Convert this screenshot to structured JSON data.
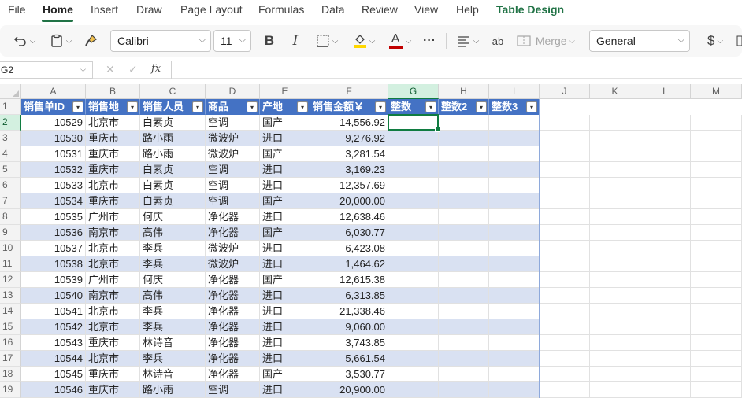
{
  "menu": {
    "items": [
      "File",
      "Home",
      "Insert",
      "Draw",
      "Page Layout",
      "Formulas",
      "Data",
      "Review",
      "View",
      "Help",
      "Table Design"
    ],
    "active": "Home"
  },
  "toolbar": {
    "font_name": "Calibri",
    "font_size": "11",
    "bold_label": "B",
    "italic_label": "I",
    "font_color_label": "A",
    "more_label": "···",
    "merge_label": "Merge",
    "number_format": "General",
    "currency_label": "$",
    "font_color_hex": "#c00000",
    "fill_color_hex": "#ffd700"
  },
  "formula_bar": {
    "name_box": "G2",
    "fx_label": "fx",
    "value": ""
  },
  "grid": {
    "columns": [
      "A",
      "B",
      "C",
      "D",
      "E",
      "F",
      "G",
      "H",
      "I",
      "J",
      "K",
      "L",
      "M"
    ],
    "selected_column": "G",
    "selected_row": "2",
    "rows": [
      "1",
      "2",
      "3",
      "4",
      "5",
      "6",
      "7",
      "8",
      "9",
      "10",
      "11",
      "12",
      "13",
      "14",
      "15",
      "16",
      "17",
      "18",
      "19"
    ],
    "header_row": [
      "销售单ID",
      "销售地",
      "销售人员",
      "商品",
      "产地",
      "销售金额￥",
      "整数",
      "整数2",
      "整数3"
    ],
    "data": [
      [
        "10529",
        "北京市",
        "白素贞",
        "空调",
        "国产",
        "14,556.92"
      ],
      [
        "10530",
        "重庆市",
        "路小雨",
        "微波炉",
        "进口",
        "9,276.92"
      ],
      [
        "10531",
        "重庆市",
        "路小雨",
        "微波炉",
        "国产",
        "3,281.54"
      ],
      [
        "10532",
        "重庆市",
        "白素贞",
        "空调",
        "进口",
        "3,169.23"
      ],
      [
        "10533",
        "北京市",
        "白素贞",
        "空调",
        "进口",
        "12,357.69"
      ],
      [
        "10534",
        "重庆市",
        "白素贞",
        "空调",
        "国产",
        "20,000.00"
      ],
      [
        "10535",
        "广州市",
        "何庆",
        "净化器",
        "进口",
        "12,638.46"
      ],
      [
        "10536",
        "南京市",
        "高伟",
        "净化器",
        "国产",
        "6,030.77"
      ],
      [
        "10537",
        "北京市",
        "李兵",
        "微波炉",
        "进口",
        "6,423.08"
      ],
      [
        "10538",
        "北京市",
        "李兵",
        "微波炉",
        "进口",
        "1,464.62"
      ],
      [
        "10539",
        "广州市",
        "何庆",
        "净化器",
        "国产",
        "12,615.38"
      ],
      [
        "10540",
        "南京市",
        "高伟",
        "净化器",
        "进口",
        "6,313.85"
      ],
      [
        "10541",
        "北京市",
        "李兵",
        "净化器",
        "进口",
        "21,338.46"
      ],
      [
        "10542",
        "北京市",
        "李兵",
        "净化器",
        "进口",
        "9,060.00"
      ],
      [
        "10543",
        "重庆市",
        "林诗音",
        "净化器",
        "进口",
        "3,743.85"
      ],
      [
        "10544",
        "北京市",
        "李兵",
        "净化器",
        "进口",
        "5,661.54"
      ],
      [
        "10545",
        "重庆市",
        "林诗音",
        "净化器",
        "国产",
        "3,530.77"
      ],
      [
        "10546",
        "重庆市",
        "路小雨",
        "空调",
        "进口",
        "20,900.00"
      ]
    ],
    "table_header_color": "#4472c4",
    "band_color": "#d9e1f2",
    "selection_color": "#107c41"
  }
}
